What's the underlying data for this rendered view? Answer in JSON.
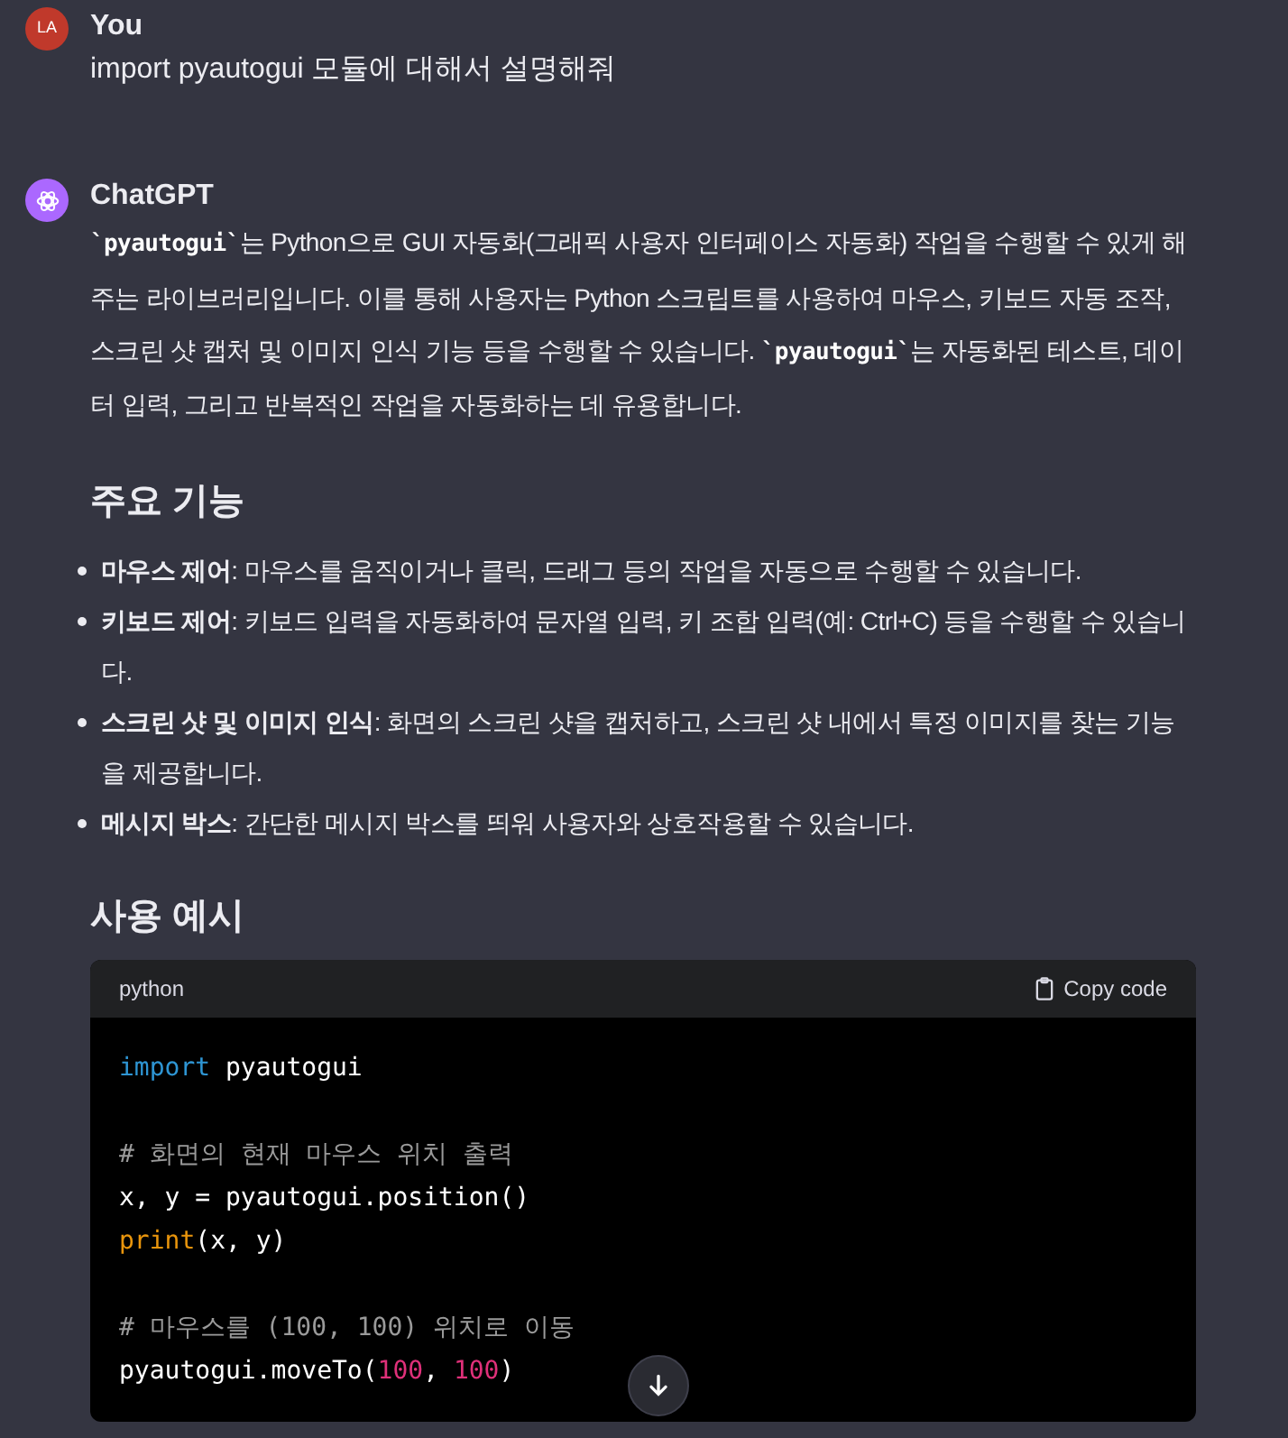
{
  "messages": [
    {
      "kind": "user",
      "avatar": "LA",
      "author": "You",
      "text": "import pyautogui 모듈에 대해서 설명해줘"
    },
    {
      "kind": "assistant",
      "author": "ChatGPT"
    }
  ],
  "answer": {
    "intro": [
      {
        "kind": "code",
        "text": "`pyautogui`"
      },
      {
        "kind": "text",
        "text": "는 Python으로 GUI 자동화(그래픽 사용자 인터페이스 자동화) 작업을 수행할 수 있게 해주는 라이브러리입니다. 이를 통해 사용자는 Python 스크립트를 사용하여 마우스, 키보드 자동 조작, 스크린 샷 캡처 및 이미지 인식 기능 등을 수행할 수 있습니다. "
      },
      {
        "kind": "code",
        "text": "`pyautogui`"
      },
      {
        "kind": "text",
        "text": "는 자동화된 테스트, 데이터 입력, 그리고 반복적인 작업을 자동화하는 데 유용합니다."
      }
    ],
    "features_heading": "주요 기능",
    "features": [
      "**마우스 제어**: 마우스를 움직이거나 클릭, 드래그 등의 작업을 자동으로 수행할 수 있습니다.",
      "**키보드 제어**: 키보드 입력을 자동화하여 문자열 입력, 키 조합 입력(예: Ctrl+C) 등을 수행할 수 있습니다.",
      "**스크린 샷 및 이미지 인식**: 화면의 스크린 샷을 캡처하고, 스크린 샷 내에서 특정 이미지를 찾는 기능을 제공합니다.",
      "**메시지 박스**: 간단한 메시지 박스를 띄워 사용자와 상호작용할 수 있습니다."
    ],
    "example_heading": "사용 예시",
    "code_block": {
      "language": "python",
      "copy_label": "Copy code",
      "lines": [
        {
          "kind": "code",
          "tokens": [
            {
              "kind": "keyword",
              "text": "import"
            },
            {
              "kind": "plain",
              "text": " pyautogui"
            }
          ]
        },
        {
          "kind": "blank"
        },
        {
          "kind": "code",
          "tokens": [
            {
              "kind": "comment",
              "text": "# 화면의 현재 마우스 위치 출력"
            }
          ]
        },
        {
          "kind": "code",
          "tokens": [
            {
              "kind": "plain",
              "text": "x, y = pyautogui.position()"
            }
          ]
        },
        {
          "kind": "code",
          "tokens": [
            {
              "kind": "builtin",
              "text": "print"
            },
            {
              "kind": "plain",
              "text": "(x, y)"
            }
          ]
        },
        {
          "kind": "blank"
        },
        {
          "kind": "code",
          "tokens": [
            {
              "kind": "comment",
              "text": "# 마우스를 (100, 100) 위치로 이동"
            }
          ]
        },
        {
          "kind": "code",
          "tokens": [
            {
              "kind": "plain",
              "text": "pyautogui.moveTo("
            },
            {
              "kind": "number",
              "text": "100"
            },
            {
              "kind": "plain",
              "text": ", "
            },
            {
              "kind": "number",
              "text": "100"
            },
            {
              "kind": "plain",
              "text": ")"
            }
          ]
        }
      ]
    }
  }
}
